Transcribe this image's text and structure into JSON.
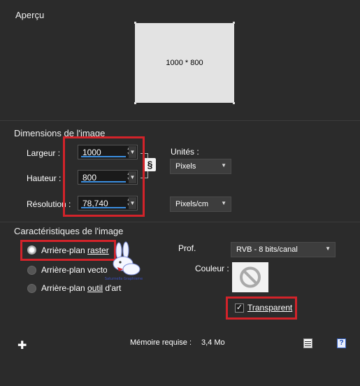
{
  "preview": {
    "title": "Aperçu",
    "size_text": "1000 * 800"
  },
  "dimensions": {
    "title": "Dimensions de l'image",
    "width_label": "Largeur :",
    "width_value": "1000",
    "height_label": "Hauteur :",
    "height_value": "800",
    "resolution_label": "Résolution :",
    "resolution_value": "78,740",
    "units_label": "Unités :",
    "units_value": "Pixels",
    "res_units_value": "Pixels/cm"
  },
  "characteristics": {
    "title": "Caractéristiques de l'image",
    "raster_label_pre": "Arrière-plan ",
    "raster_label_u": "raster",
    "vector_label": "Arrière-plan vectoriel",
    "art_label_pre": "Arrière-plan ",
    "art_label_u": "outil",
    "art_label_post": " d'art",
    "depth_label": "Prof.",
    "depth_value": "RVB - 8 bits/canal",
    "color_label": "Couleur :",
    "transparent_label": "Transparent",
    "selected": "raster"
  },
  "footer": {
    "memory_label": "Mémoire requise :",
    "memory_value": "3,4 Mo"
  },
  "colors": {
    "accent": "#d2232a",
    "background": "#2b2b2b",
    "underline": "#3b8ee0"
  },
  "icons": [
    "plus-icon",
    "link-icon",
    "no-color-icon",
    "document-icon",
    "help-icon",
    "watermark-rabbit-logo"
  ]
}
